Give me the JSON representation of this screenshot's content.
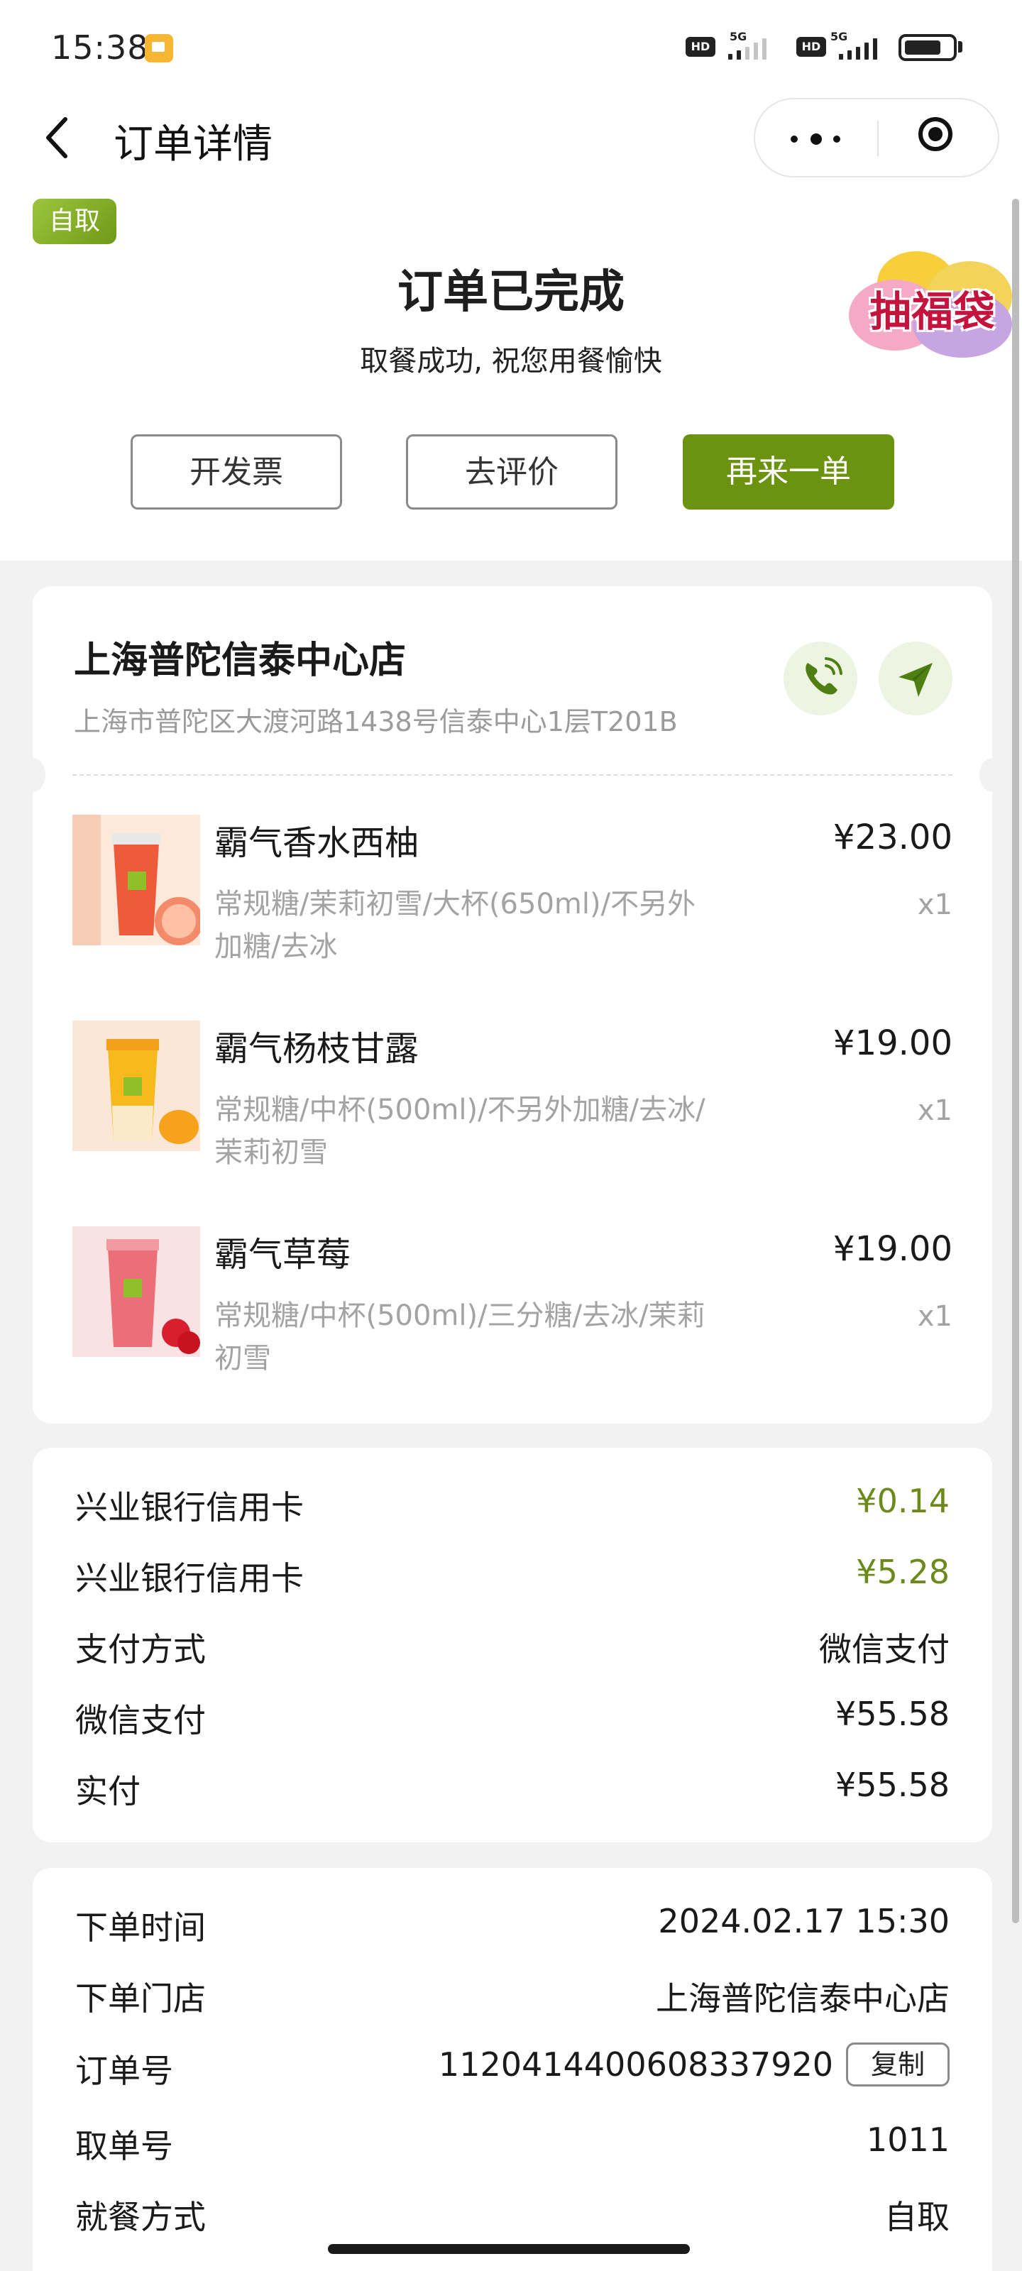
{
  "status_bar": {
    "time": "15:38",
    "hd1": "HD",
    "net1": "5G",
    "hd2": "HD",
    "net2": "5G"
  },
  "nav": {
    "title": "订单详情"
  },
  "order_status": {
    "tag": "自取",
    "title": "订单已完成",
    "subtitle": "取餐成功, 祝您用餐愉快",
    "lucky_bag": "抽福袋"
  },
  "actions": {
    "invoice": "开发票",
    "review": "去评价",
    "reorder": "再来一单"
  },
  "store": {
    "name": "上海普陀信泰中心店",
    "address": "上海市普陀区大渡河路1438号信泰中心1层T201B"
  },
  "items": [
    {
      "name": "霸气香水西柚",
      "spec": "常规糖/茉莉初雪/大杯(650ml)/不另外加糖/去冰",
      "price": "¥23.00",
      "qty": "x1"
    },
    {
      "name": "霸气杨枝甘露",
      "spec": "常规糖/中杯(500ml)/不另外加糖/去冰/茉莉初雪",
      "price": "¥19.00",
      "qty": "x1"
    },
    {
      "name": "霸气草莓",
      "spec": "常规糖/中杯(500ml)/三分糖/去冰/茉莉初雪",
      "price": "¥19.00",
      "qty": "x1"
    }
  ],
  "payment": {
    "rows": [
      {
        "label": "兴业银行信用卡",
        "value": "¥0.14"
      },
      {
        "label": "兴业银行信用卡",
        "value": "¥5.28"
      },
      {
        "label": "支付方式",
        "value": "微信支付"
      },
      {
        "label": "微信支付",
        "value": "¥55.58"
      },
      {
        "label": "实付",
        "value": "¥55.58"
      }
    ]
  },
  "order_info": {
    "rows": [
      {
        "label": "下单时间",
        "value": "2024.02.17 15:30"
      },
      {
        "label": "下单门店",
        "value": "上海普陀信泰中心店"
      },
      {
        "label": "订单号",
        "value": "1120414400608337920"
      },
      {
        "label": "取单号",
        "value": "1011"
      },
      {
        "label": "就餐方式",
        "value": "自取"
      }
    ],
    "copy_label": "复制"
  },
  "colors": {
    "brand_green": "#6b930f",
    "discount_green": "#6b8a1a",
    "lucky_bag_red": "#c4143e"
  },
  "icons": {
    "back": "chevron-left-icon",
    "more": "more-dots-icon",
    "close": "target-close-icon",
    "phone": "phone-icon",
    "navigate": "paper-plane-icon"
  }
}
